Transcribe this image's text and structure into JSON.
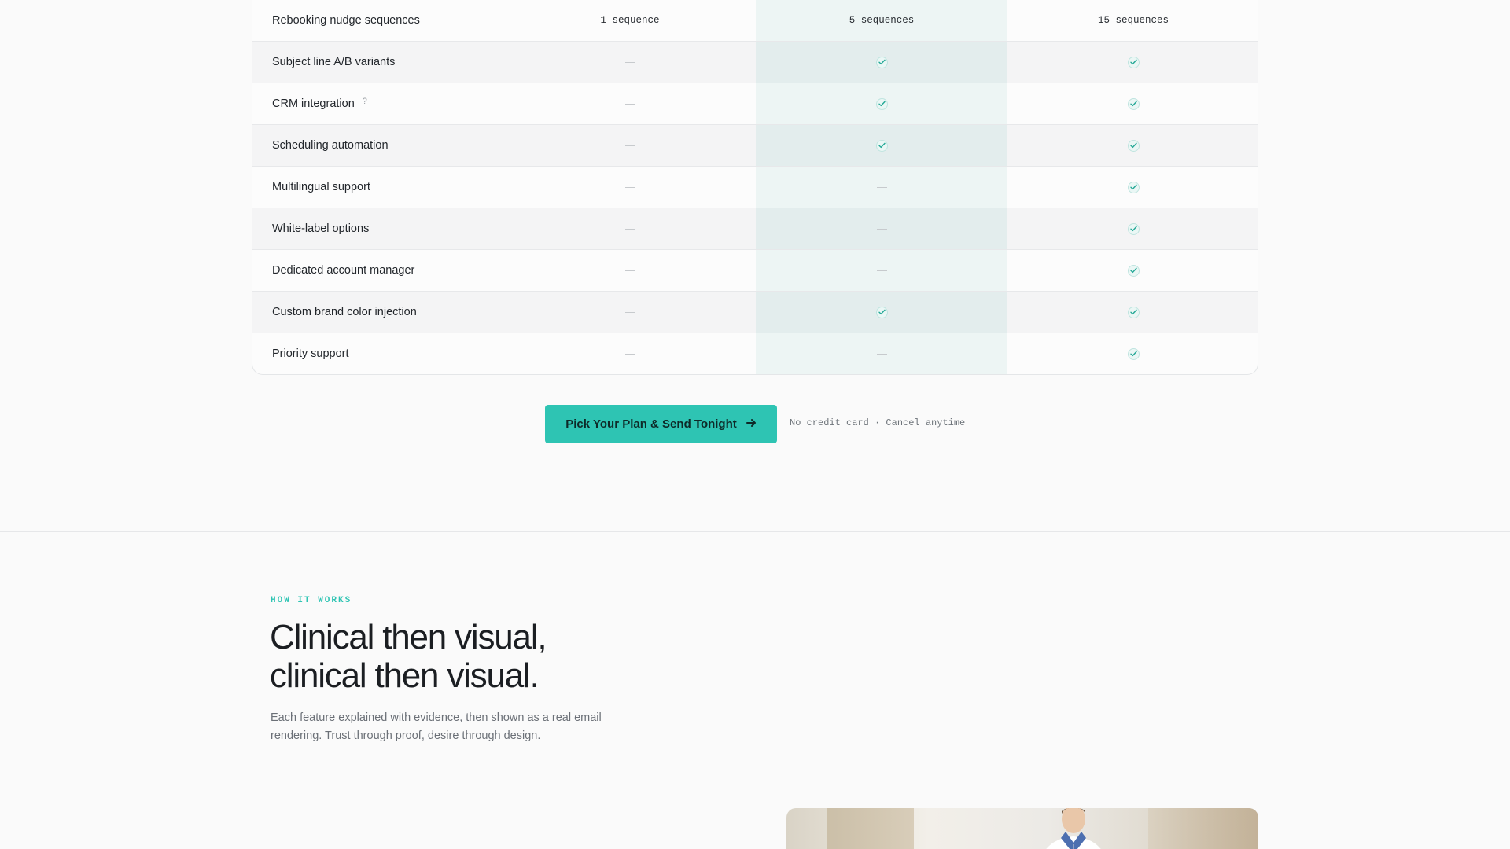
{
  "comparison": {
    "rows": [
      {
        "feature": "Rebooking nudge sequences",
        "basic": "1 sequence",
        "pro": "5 sequences",
        "premium": "15 sequences",
        "type": "text",
        "alt": false
      },
      {
        "feature": "Subject line A/B variants",
        "basic": "no",
        "pro": "yes",
        "premium": "yes",
        "type": "bool",
        "alt": true
      },
      {
        "feature": "CRM integration",
        "help": "?",
        "basic": "no",
        "pro": "yes",
        "premium": "yes",
        "type": "bool",
        "alt": false
      },
      {
        "feature": "Scheduling automation",
        "basic": "no",
        "pro": "yes",
        "premium": "yes",
        "type": "bool",
        "alt": true
      },
      {
        "feature": "Multilingual support",
        "basic": "no",
        "pro": "no",
        "premium": "yes",
        "type": "bool",
        "alt": false
      },
      {
        "feature": "White-label options",
        "basic": "no",
        "pro": "no",
        "premium": "yes",
        "type": "bool",
        "alt": true
      },
      {
        "feature": "Dedicated account manager",
        "basic": "no",
        "pro": "no",
        "premium": "yes",
        "type": "bool",
        "alt": false
      },
      {
        "feature": "Custom brand color injection",
        "basic": "no",
        "pro": "yes",
        "premium": "yes",
        "type": "bool",
        "alt": true
      },
      {
        "feature": "Priority support",
        "basic": "no",
        "pro": "no",
        "premium": "yes",
        "type": "bool",
        "alt": false
      }
    ]
  },
  "cta": {
    "button_label": "Pick Your Plan & Send Tonight",
    "note": "No credit card · Cancel anytime"
  },
  "how_it_works": {
    "eyebrow": "HOW IT WORKS",
    "headline_line1": "Clinical then visual,",
    "headline_line2": "clinical then visual.",
    "description": "Each feature explained with evidence, then shown as a real email rendering. Trust through proof, desire through design."
  },
  "icons": {
    "check": "check-circle-icon",
    "dash": "dash-icon",
    "arrow": "arrow-right-icon"
  },
  "colors": {
    "accent": "#2ec4b3",
    "text": "#1f2329",
    "muted": "#6b7077",
    "highlight_column": "#e3f1ef"
  }
}
